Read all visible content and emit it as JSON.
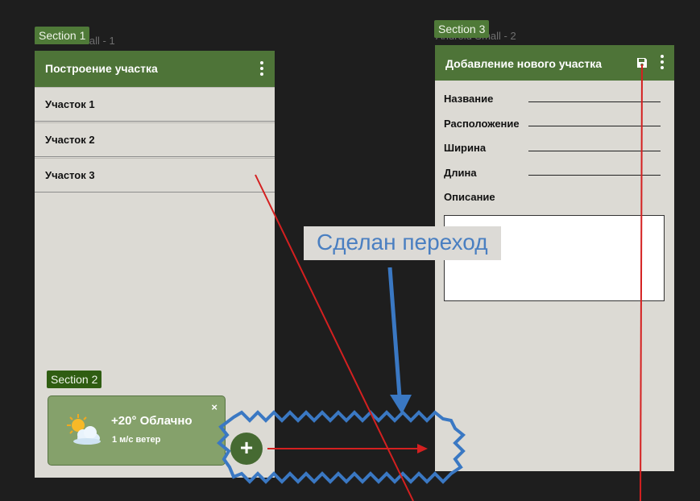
{
  "frame1": {
    "label": "Android Small - 1",
    "section_tag": "Section 1",
    "appbar_title": "Построение участка",
    "items": [
      "Участок 1",
      "Участок 2",
      "Участок 3"
    ],
    "section2_tag": "Section 2",
    "weather": {
      "temperature": "+20° Облачно",
      "wind": "1 м/с ветер",
      "close": "×"
    },
    "fab_label": "+"
  },
  "frame2": {
    "label": "Android Small - 2",
    "section_tag": "Section 3",
    "appbar_title": "Добавление нового участка",
    "fields": [
      "Название",
      "Расположение",
      "Ширина",
      "Длина"
    ],
    "description_label": "Описание"
  },
  "callout": "Сделан переход",
  "colors": {
    "canvas": "#1e1e1e",
    "appbar": "#4e7438",
    "phone_bg": "#dcdad4",
    "annotation_red": "#d42020",
    "annotation_blue": "#3a78c3"
  }
}
